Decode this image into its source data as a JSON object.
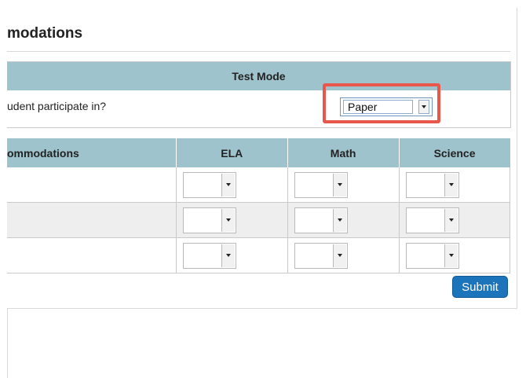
{
  "panel": {
    "title": "modations"
  },
  "test_mode": {
    "header": "Test Mode",
    "question": "udent participate in?",
    "select": {
      "value": "Paper"
    }
  },
  "accommodations": {
    "columns": [
      "ommodations",
      "ELA",
      "Math",
      "Science"
    ],
    "rows": [
      {
        "label": "",
        "values": [
          "",
          "",
          ""
        ]
      },
      {
        "label": "",
        "values": [
          "",
          "",
          ""
        ]
      },
      {
        "label": "",
        "values": [
          "",
          "",
          ""
        ]
      }
    ]
  },
  "actions": {
    "submit_label": "Submit"
  },
  "colors": {
    "header_bg": "#9ec3cc",
    "highlight": "#e8574a",
    "submit_bg": "#1c74bb",
    "alt_row_bg": "#eeeeee"
  }
}
